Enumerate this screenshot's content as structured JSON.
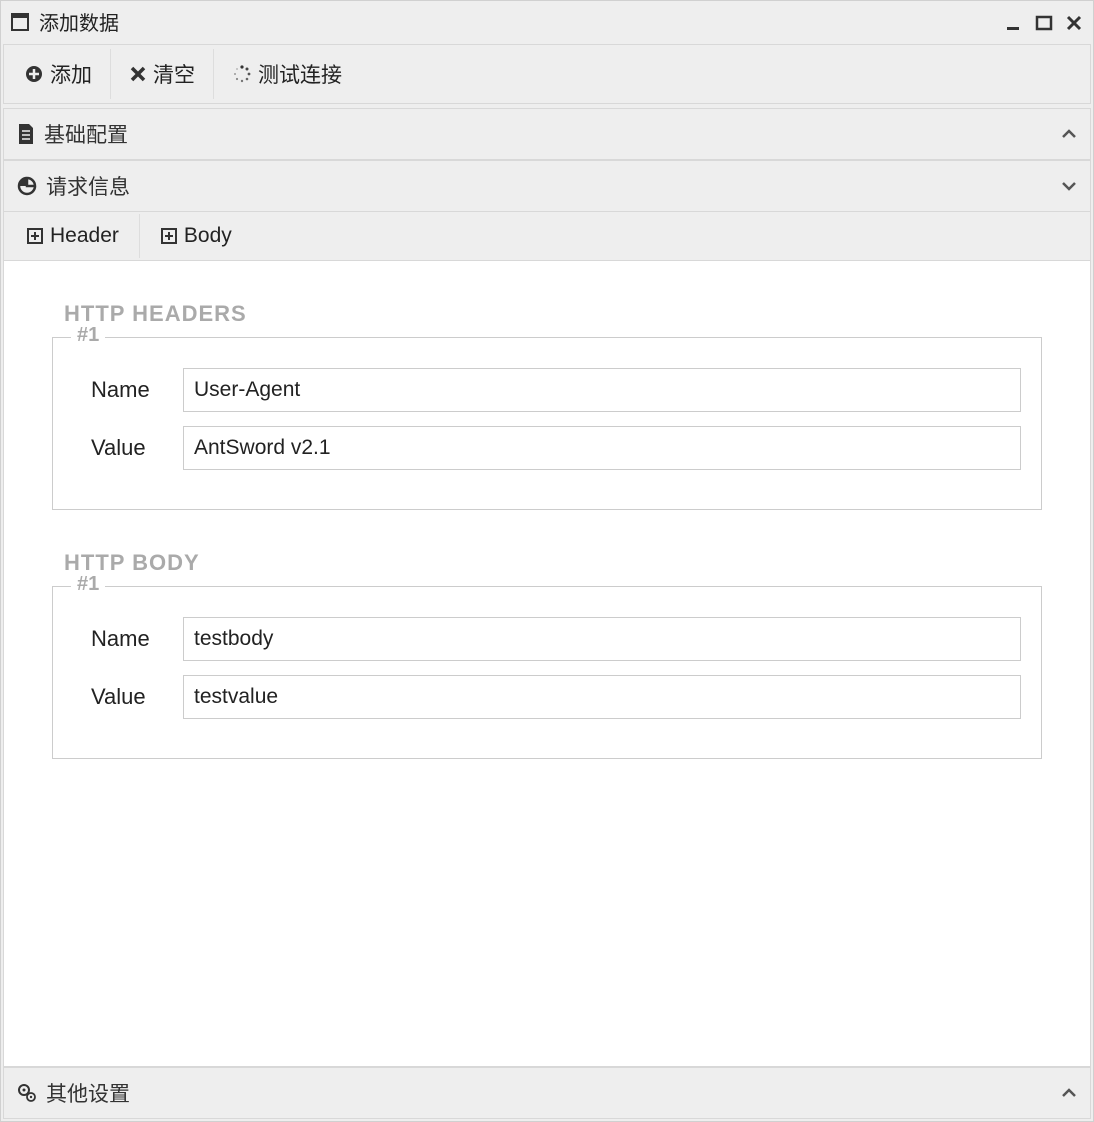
{
  "window": {
    "title": "添加数据"
  },
  "toolbar": {
    "add": "添加",
    "clear": "清空",
    "test": "测试连接"
  },
  "accordion": {
    "basic_config": "基础配置",
    "request_info": "请求信息",
    "other_settings": "其他设置"
  },
  "subtoolbar": {
    "header": "Header",
    "body": "Body"
  },
  "sections": {
    "http_headers": "HTTP HEADERS",
    "http_body": "HTTP BODY"
  },
  "labels": {
    "name": "Name",
    "value": "Value",
    "group1": "#1"
  },
  "headers": {
    "0": {
      "name": "User-Agent",
      "value": "AntSword v2.1"
    }
  },
  "body": {
    "0": {
      "name": "testbody",
      "value": "testvalue"
    }
  }
}
